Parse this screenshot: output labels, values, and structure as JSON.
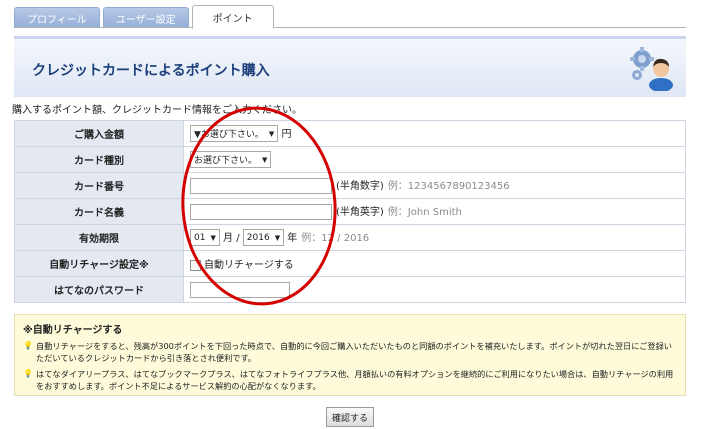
{
  "tabs": [
    {
      "label": "プロフィール"
    },
    {
      "label": "ユーザー設定"
    },
    {
      "label": "ポイント"
    }
  ],
  "header": {
    "title": "クレジットカードによるポイント購入"
  },
  "intro": "購入するポイント額、クレジットカード情報をご入力ください。",
  "form": {
    "amount": {
      "label": "ご購入金額",
      "select": "▼お選び下さい。",
      "unit": "円"
    },
    "card_type": {
      "label": "カード種別",
      "select": "お選び下さい。"
    },
    "card_number": {
      "label": "カード番号",
      "hint": "(半角数字)",
      "example": "例：1234567890123456"
    },
    "card_name": {
      "label": "カード名義",
      "hint": "(半角英字)",
      "example": "例：John Smith"
    },
    "expiry": {
      "label": "有効期限",
      "month": "01",
      "month_unit": "月 /",
      "year": "2016",
      "year_unit": "年",
      "example": "例：12 / 2016"
    },
    "auto_recharge": {
      "label": "自動リチャージ設定※",
      "checkbox_label": "自動リチャージする"
    },
    "password": {
      "label": "はてなのパスワード"
    }
  },
  "notice": {
    "title": "※自動リチャージする",
    "items": [
      "自動リチャージをすると、残高が300ポイントを下回った時点で、自動的に今回ご購入いただいたものと同額のポイントを補充いたします。ポイントが切れた翌日にご登録いただいているクレジットカードから引き落とされ便利です。",
      "はてなダイアリープラス、はてなブックマークプラス、はてなフォトライフプラス他、月額払いの有料オプションを継続的にご利用になりたい場合は、自動リチャージの利用をおすすめします。ポイント不足によるサービス解約の心配がなくなります。"
    ]
  },
  "confirm_label": "確認する",
  "colors": {
    "title": "#1c3f7c",
    "annotation": "#d40000",
    "notice_bg": "#fdfbd9",
    "label_bg": "#e3e8f1"
  }
}
